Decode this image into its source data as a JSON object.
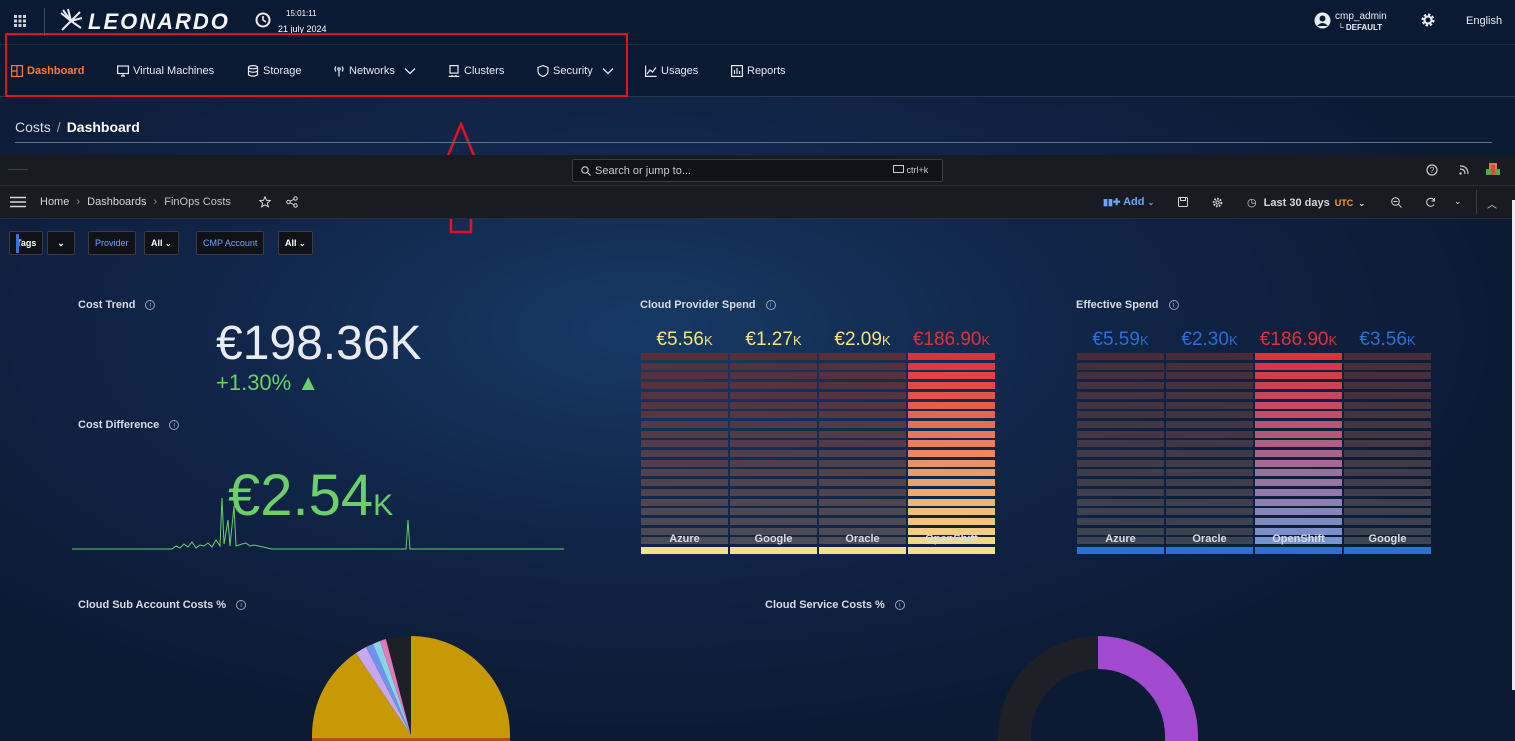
{
  "header": {
    "logo": "LEONARDO",
    "time": "15:01:11",
    "date": "21 july 2024",
    "user": "cmp_admin",
    "tenant": "DEFAULT",
    "language": "English"
  },
  "nav": {
    "items": [
      {
        "label": "Dashboard",
        "icon": "dashboard-icon"
      },
      {
        "label": "Virtual Machines",
        "icon": "monitor-icon"
      },
      {
        "label": "Storage",
        "icon": "database-icon"
      },
      {
        "label": "Networks",
        "icon": "antenna-icon"
      },
      {
        "label": "Clusters",
        "icon": "server-icon"
      },
      {
        "label": "Security",
        "icon": "shield-icon"
      },
      {
        "label": "Usages",
        "icon": "chart-icon"
      },
      {
        "label": "Reports",
        "icon": "report-icon"
      }
    ]
  },
  "breadcrumb": {
    "parent": "Costs",
    "sep": "/",
    "current": "Dashboard"
  },
  "grafana": {
    "search_placeholder": "Search or jump to...",
    "search_shortcut": "ctrl+k",
    "crumbs": [
      "Home",
      "Dashboards",
      "FinOps Costs"
    ],
    "crumb_sep": "›",
    "add_label": "Add",
    "time_range": "Last 30 days",
    "tz": "UTC",
    "vars": {
      "tags": "Tags",
      "provider": "Provider",
      "provider_val": "All",
      "cmp": "CMP Account",
      "cmp_val": "All"
    }
  },
  "panels": {
    "cost_trend": {
      "title": "Cost Trend",
      "value": "€198.36K",
      "change": "+1.30% ▲"
    },
    "cost_diff": {
      "title": "Cost Difference",
      "value": "€2.54",
      "unit": "K"
    },
    "cloud_provider": {
      "title": "Cloud Provider Spend"
    },
    "effective": {
      "title": "Effective Spend"
    },
    "sub_account": {
      "title": "Cloud Sub Account Costs %"
    },
    "service": {
      "title": "Cloud Service Costs %"
    }
  },
  "chart_data": [
    {
      "type": "bar",
      "title": "Cloud Provider Spend",
      "categories": [
        "Azure",
        "Google",
        "Oracle",
        "OpenShift"
      ],
      "labels": [
        "€5.56K",
        "€1.27K",
        "€2.09K",
        "€186.90K"
      ],
      "values": [
        5.56,
        1.27,
        2.09,
        186.9
      ],
      "label_colors": [
        "#f5e27a",
        "#f5e27a",
        "#f5e27a",
        "#e0303a"
      ]
    },
    {
      "type": "bar",
      "title": "Effective Spend",
      "categories": [
        "Azure",
        "Oracle",
        "OpenShift",
        "Google"
      ],
      "labels": [
        "€5.59K",
        "€2.30K",
        "€186.90K",
        "€3.56K"
      ],
      "values": [
        5.59,
        2.3,
        186.9,
        3.56
      ],
      "label_colors": [
        "#2c6fd6",
        "#2c6fd6",
        "#e0303a",
        "#2c6fd6"
      ]
    },
    {
      "type": "pie",
      "title": "Cloud Sub Account Costs %"
    },
    {
      "type": "pie",
      "title": "Cloud Service Costs %"
    }
  ]
}
